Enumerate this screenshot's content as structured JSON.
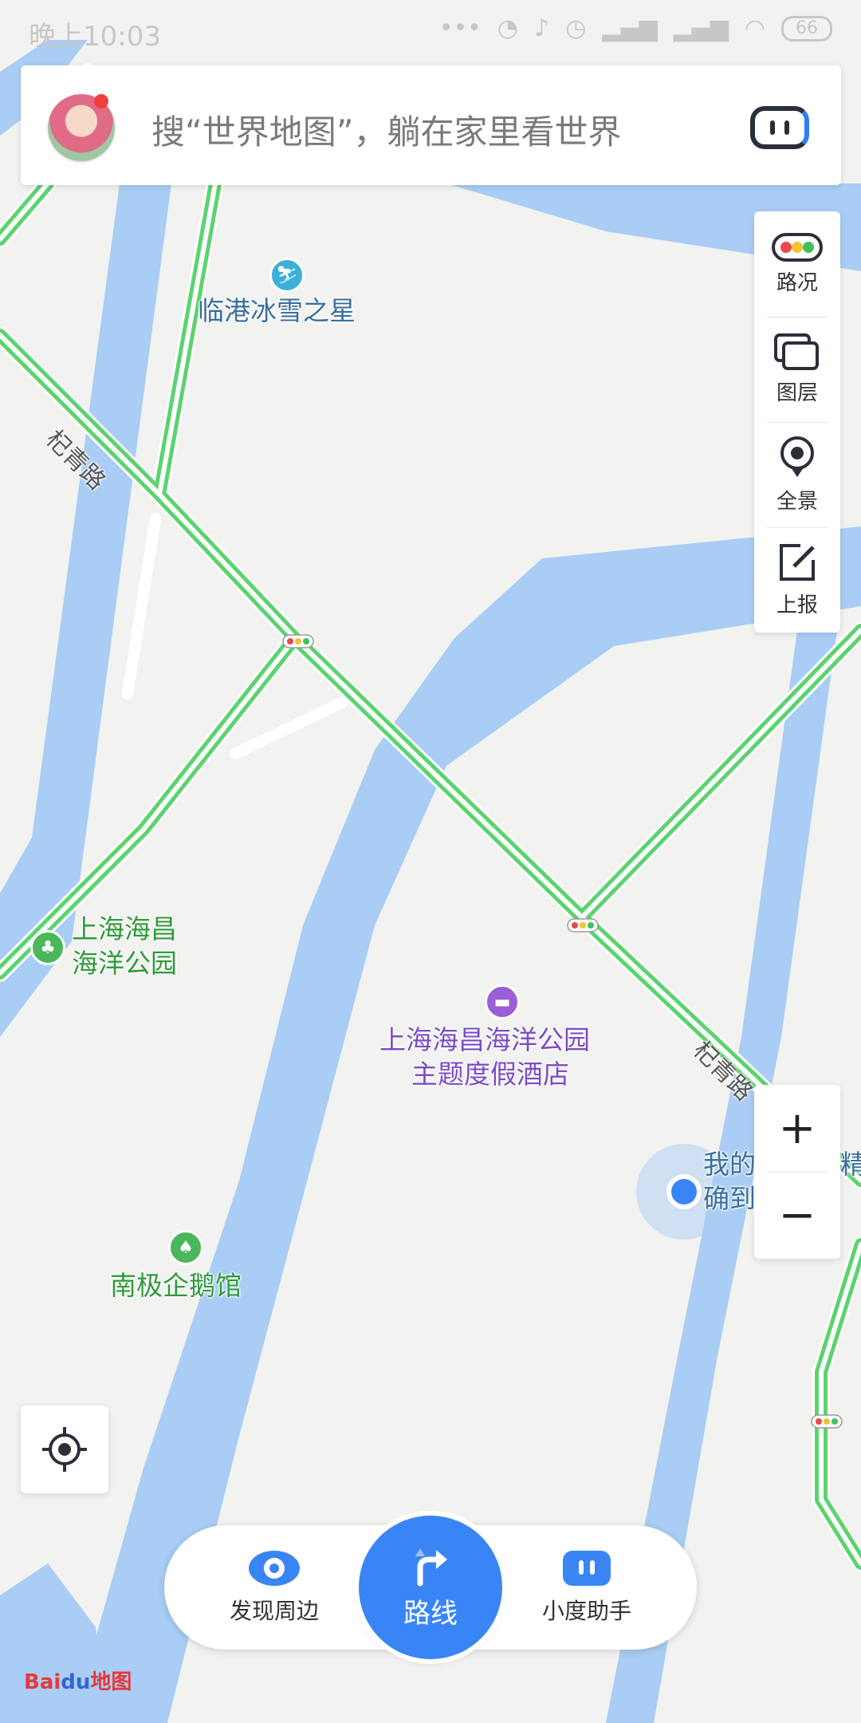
{
  "status_bar": {
    "time": "晚上10:03",
    "battery": "66"
  },
  "search": {
    "placeholder": "搜“世界地图”，躺在家里看世界"
  },
  "tools": {
    "traffic": "路况",
    "layers": "图层",
    "panorama": "全景",
    "report": "上报"
  },
  "zoom": {
    "in": "+",
    "out": "−"
  },
  "map_labels": {
    "ice_star": "临港冰雪之星",
    "road_a": "杞青路",
    "road_b": "杞青路",
    "park_line1": "上海海昌",
    "park_line2": "海洋公园",
    "hotel_line1": "上海海昌海洋公园",
    "hotel_line2": "主题度假酒店",
    "penguin": "南极企鹅馆",
    "my_location_line1": "我的",
    "my_location_line2": "确到",
    "my_location_tail": "精"
  },
  "bottom_nav": {
    "discover": "发现周边",
    "route": "路线",
    "assistant": "小度助手"
  },
  "logo": {
    "bai": "Bai",
    "du": "du",
    "map": "地图"
  },
  "colors": {
    "water": "#a9cdf4",
    "land": "#f2f2f1",
    "road_green": "#5cd36f",
    "accent_blue": "#3a85f6",
    "hotel_purple": "#7c4cc7",
    "park_green": "#2f9b3a",
    "poi_blue_text": "#3b6f9f"
  },
  "icons": {
    "avatar": "avatar",
    "assistant": "assistant-icon",
    "traffic": "traffic-light-icon",
    "layers": "layers-icon",
    "panorama": "panorama-pin-icon",
    "report": "report-edit-icon",
    "locate": "locate-crosshair-icon",
    "discover": "eye-icon",
    "route": "route-arrow-icon"
  }
}
